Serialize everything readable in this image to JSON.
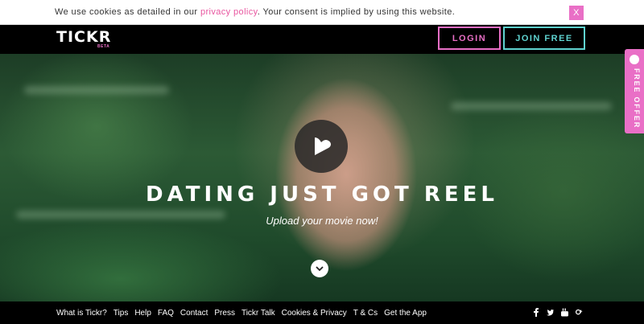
{
  "cookie_bar": {
    "text_before": "We use cookies as detailed in our ",
    "link_text": "privacy policy",
    "text_after": ". Your consent is implied by using this website.",
    "close_label": "X"
  },
  "header": {
    "logo": "TICKR",
    "logo_tag": "BETA",
    "login_label": "LOGIN",
    "join_label": "JOIN FREE"
  },
  "hero": {
    "title": "DATING JUST GOT REEL",
    "subtitle": "Upload your movie now!"
  },
  "side_tab": {
    "label": "FREE OFFER"
  },
  "footer": {
    "links": [
      "What is Tickr?",
      "Tips",
      "Help",
      "FAQ",
      "Contact",
      "Press",
      "Tickr Talk",
      "Cookies & Privacy",
      "T & Cs",
      "Get the App"
    ],
    "social": [
      "facebook-icon",
      "twitter-icon",
      "youtube-icon",
      "google-plus-icon"
    ]
  },
  "colors": {
    "accent_pink": "#e96fc6",
    "accent_teal": "#5fd3d0"
  }
}
